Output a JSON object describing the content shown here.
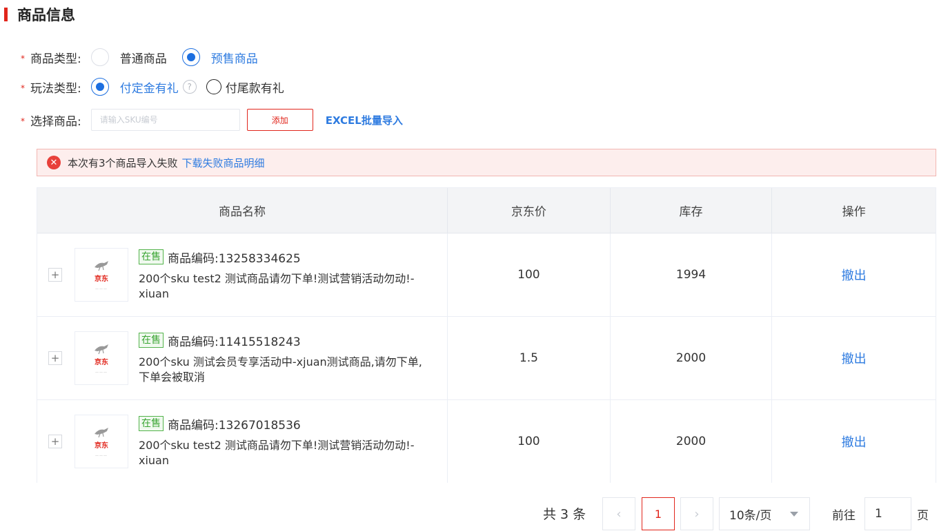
{
  "section": {
    "title": "商品信息"
  },
  "form": {
    "required_mark": "*",
    "product_type": {
      "label": "商品类型:",
      "options": [
        {
          "label": "普通商品",
          "checked": false
        },
        {
          "label": "预售商品",
          "checked": true
        }
      ]
    },
    "play_type": {
      "label": "玩法类型:",
      "options": [
        {
          "label": "付定金有礼",
          "checked": true
        },
        {
          "label": "付尾款有礼",
          "checked": false
        }
      ],
      "help_glyph": "?"
    },
    "select_product": {
      "label": "选择商品:",
      "input_value": "",
      "input_placeholder": "请输入SKU编号",
      "add_label": "添加",
      "excel_label": "EXCEL批量导入"
    }
  },
  "alert": {
    "icon": "close-circle-icon",
    "text": "本次有3个商品导入失败",
    "link": "下载失败商品明细",
    "color": "#e8403a"
  },
  "table": {
    "headers": [
      "商品名称",
      "京东价",
      "库存",
      "操作"
    ],
    "rows": [
      {
        "status": "在售",
        "code": "商品编码:13258334625",
        "name": "200个sku test2 测试商品请勿下单!测试营销活动勿动!-xiuan",
        "price": "100",
        "stock": "1994",
        "action": "撤出",
        "thumb_logo": "京东"
      },
      {
        "status": "在售",
        "code": "商品编码:11415518243",
        "name": "200个sku 测试会员专享活动中-xjuan测试商品,请勿下单,下单会被取消",
        "price": "1.5",
        "stock": "2000",
        "action": "撤出",
        "thumb_logo": "京东"
      },
      {
        "status": "在售",
        "code": "商品编码:13267018536",
        "name": "200个sku test2 测试商品请勿下单!测试营销活动勿动!-xiuan",
        "price": "100",
        "stock": "2000",
        "action": "撤出",
        "thumb_logo": "京东"
      }
    ]
  },
  "pagination": {
    "total": "共 3 条",
    "current_page": "1",
    "page_size": "10条/页",
    "goto_label": "前往",
    "goto_value": "1",
    "page_suffix": "页"
  },
  "colors": {
    "accent": "#e1251b",
    "link": "#2e7be0",
    "success": "#3aa533"
  }
}
